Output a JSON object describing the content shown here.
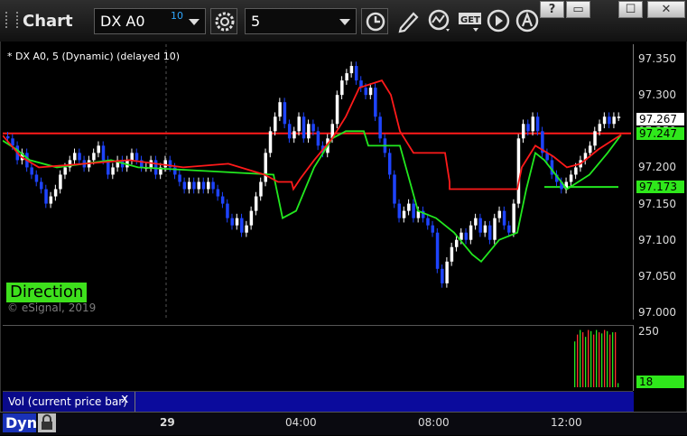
{
  "window": {
    "title": "Chart",
    "symbol": "DX A0",
    "symbol_badge": "10",
    "interval": "5",
    "buttons": {
      "help": "?",
      "restore": "▭",
      "maximize": "☐",
      "close": "✕"
    }
  },
  "toolbar_icons": [
    "settings-icon",
    "clock-icon",
    "pencil-icon",
    "studies-icon",
    "get-icon",
    "play-icon",
    "alert-icon"
  ],
  "chart": {
    "legend": "* DX A0, 5 (Dynamic) (delayed 10)",
    "direction_label": "Direction",
    "copyright": "© eSignal, 2019",
    "y_ticks": [
      "97.350",
      "97.300",
      "97.250",
      "97.200",
      "97.150",
      "97.100",
      "97.050",
      "97.000"
    ],
    "price_tags": [
      {
        "label": "97.267",
        "bg": "#ffffff",
        "fg": "#000000"
      },
      {
        "label": "97.247",
        "bg": "#2fe81b",
        "fg": "#000000"
      },
      {
        "label": "97.173",
        "bg": "#2fe81b",
        "fg": "#000000"
      }
    ],
    "colors": {
      "up": "#ffffff",
      "down": "#1e44ff",
      "red_line": "#ff1a1a",
      "green_line": "#22e81f",
      "volume_up": "#22e81f",
      "volume_down": "#ff3030",
      "grid": "#555555"
    }
  },
  "volume": {
    "label": "Vol (current price bar)",
    "close_x": "x",
    "y_ticks": [
      "250"
    ],
    "tag": "18"
  },
  "timeaxis": {
    "mode": "Dyn",
    "labels": [
      "29",
      "04:00",
      "08:00",
      "12:00"
    ]
  },
  "chart_data": {
    "type": "candlestick",
    "y_range": [
      96.99,
      97.37
    ],
    "close": [
      97.24,
      97.23,
      97.21,
      97.22,
      97.2,
      97.19,
      97.18,
      97.17,
      97.15,
      97.16,
      97.17,
      97.19,
      97.2,
      97.21,
      97.22,
      97.21,
      97.2,
      97.21,
      97.22,
      97.23,
      97.21,
      97.19,
      97.2,
      97.21,
      97.2,
      97.21,
      97.22,
      97.21,
      97.2,
      97.2,
      97.21,
      97.19,
      97.2,
      97.21,
      97.2,
      97.19,
      97.18,
      97.17,
      97.18,
      97.17,
      97.18,
      97.17,
      97.18,
      97.17,
      97.16,
      97.15,
      97.13,
      97.12,
      97.13,
      97.11,
      97.12,
      97.14,
      97.16,
      97.18,
      97.22,
      97.25,
      97.27,
      97.29,
      97.26,
      97.24,
      97.25,
      97.27,
      97.24,
      97.26,
      97.25,
      97.23,
      97.22,
      97.24,
      97.26,
      97.3,
      97.32,
      97.33,
      97.34,
      97.32,
      97.31,
      97.3,
      97.31,
      97.27,
      97.24,
      97.22,
      97.19,
      97.15,
      97.13,
      97.14,
      97.15,
      97.13,
      97.14,
      97.13,
      97.12,
      97.11,
      97.06,
      97.04,
      97.07,
      97.09,
      97.1,
      97.11,
      97.1,
      97.12,
      97.13,
      97.11,
      97.12,
      97.1,
      97.13,
      97.14,
      97.12,
      97.11,
      97.15,
      97.24,
      97.26,
      97.25,
      97.27,
      97.25,
      97.22,
      97.21,
      97.19,
      97.18,
      97.17,
      97.18,
      97.19,
      97.2,
      97.21,
      97.22,
      97.23,
      97.25,
      97.26,
      97.27,
      97.26,
      97.27,
      97.27
    ],
    "red_line": [
      [
        0,
        97.244
      ],
      [
        20,
        97.215
      ],
      [
        40,
        97.2
      ],
      [
        140,
        97.21
      ],
      [
        200,
        97.2
      ],
      [
        250,
        97.205
      ],
      [
        290,
        97.19
      ],
      [
        305,
        97.18
      ],
      [
        320,
        97.18
      ],
      [
        322,
        97.17
      ],
      [
        330,
        97.185
      ],
      [
        345,
        97.21
      ],
      [
        365,
        97.24
      ],
      [
        380,
        97.27
      ],
      [
        395,
        97.31
      ],
      [
        420,
        97.32
      ],
      [
        430,
        97.3
      ],
      [
        440,
        97.25
      ],
      [
        455,
        97.22
      ],
      [
        475,
        97.22
      ],
      [
        490,
        97.22
      ],
      [
        495,
        97.18
      ],
      [
        495,
        97.17
      ],
      [
        570,
        97.17
      ],
      [
        575,
        97.2
      ],
      [
        590,
        97.23
      ],
      [
        610,
        97.215
      ],
      [
        625,
        97.2
      ],
      [
        640,
        97.205
      ],
      [
        660,
        97.225
      ],
      [
        685,
        97.245
      ]
    ],
    "green_line": [
      [
        0,
        97.237
      ],
      [
        15,
        97.225
      ],
      [
        30,
        97.21
      ],
      [
        60,
        97.2
      ],
      [
        120,
        97.21
      ],
      [
        150,
        97.2
      ],
      [
        300,
        97.19
      ],
      [
        310,
        97.13
      ],
      [
        325,
        97.14
      ],
      [
        335,
        97.17
      ],
      [
        345,
        97.2
      ],
      [
        365,
        97.24
      ],
      [
        380,
        97.25
      ],
      [
        400,
        97.25
      ],
      [
        405,
        97.23
      ],
      [
        440,
        97.23
      ],
      [
        460,
        97.14
      ],
      [
        480,
        97.13
      ],
      [
        500,
        97.11
      ],
      [
        520,
        97.08
      ],
      [
        530,
        97.07
      ],
      [
        550,
        97.1
      ],
      [
        570,
        97.11
      ],
      [
        580,
        97.17
      ],
      [
        590,
        97.22
      ],
      [
        600,
        97.21
      ],
      [
        625,
        97.17
      ],
      [
        650,
        97.19
      ],
      [
        670,
        97.22
      ],
      [
        685,
        97.245
      ]
    ],
    "hlines": [
      {
        "y": 97.247,
        "color": "red"
      },
      {
        "y": 97.173,
        "color": "green",
        "from": 600
      }
    ],
    "volume_bars": [
      200,
      230,
      250,
      240,
      220,
      250,
      245,
      230,
      250,
      240,
      235,
      250,
      245,
      230,
      240,
      240,
      18
    ]
  }
}
